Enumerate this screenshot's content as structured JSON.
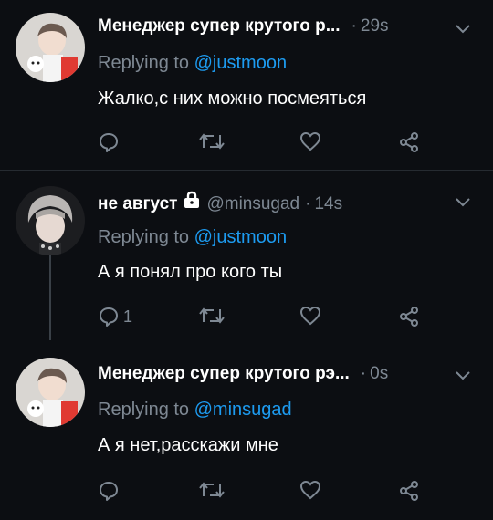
{
  "tweets": [
    {
      "author": "Менеджер супер крутого р...",
      "handle": "",
      "time": "29s",
      "replying_prefix": "Replying to",
      "replying_to": "@justmoon",
      "text": "Жалко,с них можно посмеяться",
      "reply_count": ""
    },
    {
      "author": "не август",
      "handle": "@minsugad",
      "time": "14s",
      "replying_prefix": "Replying to",
      "replying_to": "@justmoon",
      "text": "А я понял про кого ты",
      "reply_count": "1"
    },
    {
      "author": "Менеджер супер крутого рэ...",
      "handle": "",
      "time": "0s",
      "replying_prefix": "Replying to",
      "replying_to": "@minsugad",
      "text": "А я нет,расскажи мне",
      "reply_count": ""
    }
  ],
  "icons": {
    "reply": "reply-icon",
    "retweet": "retweet-icon",
    "like": "heart-icon",
    "share": "share-icon",
    "menu": "chevron-down-icon",
    "protected": "lock-icon"
  },
  "colors": {
    "background": "#0c0e12",
    "secondary_text": "#7e8893",
    "link": "#1d9bf0",
    "divider": "#262b31"
  }
}
